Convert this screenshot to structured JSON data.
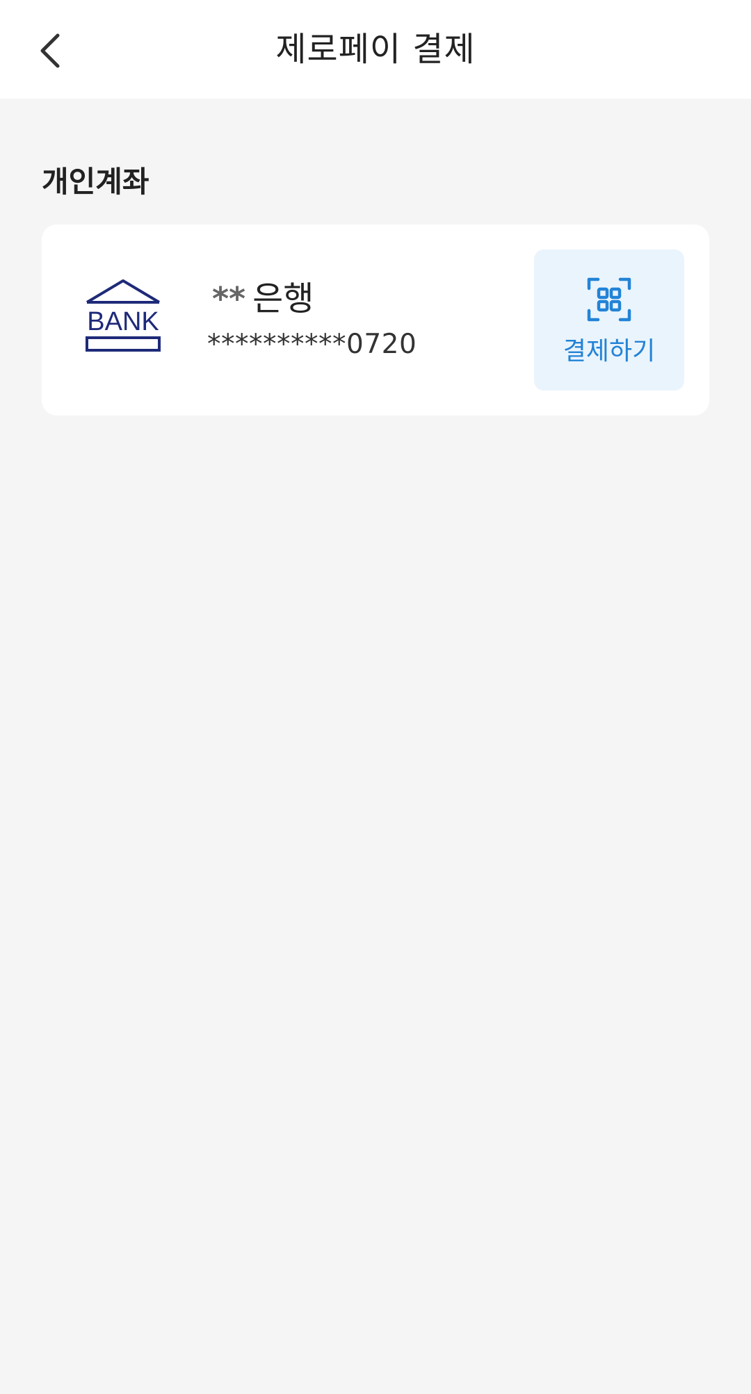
{
  "header": {
    "title": "제로페이 결제",
    "back_icon": "chevron-left-icon"
  },
  "section": {
    "title": "개인계좌"
  },
  "account": {
    "bank_logo_icon": "bank-icon",
    "bank_logo_text": "BANK",
    "bank_name_mask": "**",
    "bank_name": "은행",
    "account_number": "**********0720",
    "pay_button": {
      "label": "결제하기",
      "icon": "qr-scan-icon"
    }
  },
  "colors": {
    "background": "#f5f5f5",
    "card": "#ffffff",
    "bank_logo": "#1e2a78",
    "pay_button_bg": "#eaf4fd",
    "accent": "#2283d6"
  }
}
